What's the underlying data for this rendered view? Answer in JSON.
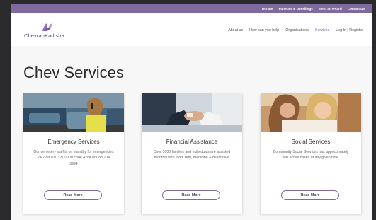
{
  "topbar": {
    "links": [
      "Donate",
      "Funerals & Unveilings",
      "Send an e-card",
      "Contact Us"
    ]
  },
  "logo": {
    "text": "ChevrahKadisha"
  },
  "nav": {
    "items": [
      "About us",
      "How can you help",
      "Organisations",
      "Services",
      "Log In | Register"
    ],
    "active": "Services"
  },
  "page": {
    "title": "Chev Services"
  },
  "cards": [
    {
      "title": "Emergency Services",
      "description": "Our cemetery staff is on standby for emergencies 24/7 on 011 321 0000 code 4284 or 083 704 3994",
      "button": "Read More"
    },
    {
      "title": "Financial Assistance",
      "description": "Over 1000 families and individuals are assisted monthly with food, rent, medicine & healthcare",
      "button": "Read More"
    },
    {
      "title": "Social Services",
      "description": "Community Social Services has approximately 800 active cases at any given time.",
      "button": "Read More"
    }
  ],
  "colors": {
    "brand_purple": "#7e6a9e",
    "active_nav": "#7a5fa8",
    "page_background": "#f7f7f7",
    "outer_background": "#2a2a2c"
  }
}
